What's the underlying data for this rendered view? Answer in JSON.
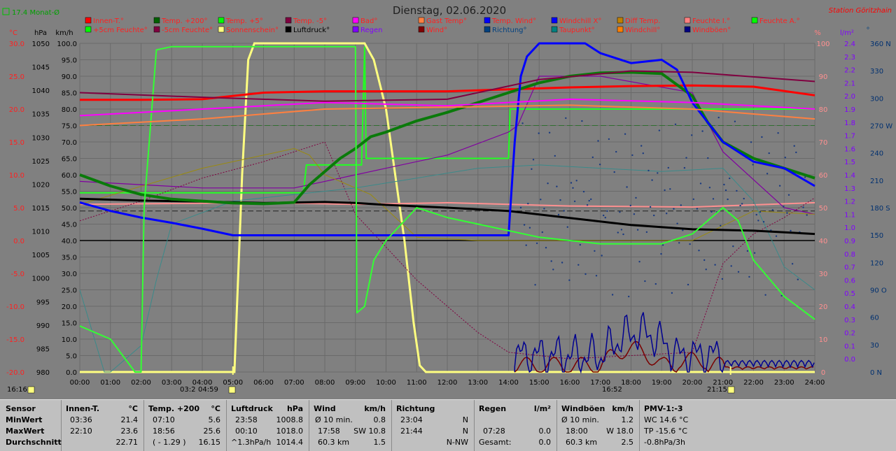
{
  "header": {
    "title": "Dienstag, 02.06.2020",
    "station": "Station Göritzhain",
    "month_avg": "17.4 Monat-Ø"
  },
  "axes": {
    "temp_label": "°C",
    "pressure_label": "hPa",
    "wind_label": "km/h",
    "humidity_label": "%",
    "rain_label": "l/m²",
    "direction_label": "°",
    "temp_ticks": [
      "30.0",
      "25.0",
      "20.0",
      "15.0",
      "10.0",
      "5.0",
      "0.0",
      "-5.0",
      "-10.0",
      "-15.0",
      "-20.0"
    ],
    "pressure_ticks": [
      "1050",
      "1045",
      "1040",
      "1035",
      "1030",
      "1025",
      "1020",
      "1015",
      "1010",
      "1005",
      "1000",
      "995",
      "990",
      "985",
      "980"
    ],
    "wind_ticks": [
      "100.0",
      "95.0",
      "90.0",
      "85.0",
      "80.0",
      "75.0",
      "70.0",
      "65.0",
      "60.0",
      "55.0",
      "50.0",
      "45.0",
      "40.0",
      "35.0",
      "30.0",
      "25.0",
      "20.0",
      "15.0",
      "10.0",
      "5.0",
      "0.0"
    ],
    "humidity_ticks": [
      "100",
      "90",
      "80",
      "70",
      "60",
      "50",
      "40",
      "30",
      "20",
      "10",
      "0"
    ],
    "rain_ticks": [
      "2.4",
      "2.3",
      "2.2",
      "2.1",
      "2.0",
      "1.9",
      "1.8",
      "1.7",
      "1.6",
      "1.5",
      "1.4",
      "1.3",
      "1.2",
      "1.1",
      "1.0",
      "0.9",
      "0.8",
      "0.7",
      "0.6",
      "0.5",
      "0.4",
      "0.3",
      "0.2",
      "0.1",
      "0.0"
    ],
    "direction_ticks": [
      "360 N",
      "330",
      "300",
      "270 W",
      "240",
      "210",
      "180 S",
      "150",
      "120",
      "90 O",
      "60",
      "30",
      "0   N"
    ],
    "time_ticks": [
      "00:00",
      "01:00",
      "02:00",
      "03:00",
      "04:00",
      "05:00",
      "06:00",
      "07:00",
      "08:00",
      "09:00",
      "10:00",
      "11:00",
      "12:00",
      "13:00",
      "14:00",
      "15:00",
      "16:00",
      "17:00",
      "18:00",
      "19:00",
      "20:00",
      "21:00",
      "22:00",
      "23:00",
      "24:00"
    ],
    "sun_marks": [
      "16:16",
      "03:2",
      "04:59",
      "16:52",
      "21:15"
    ]
  },
  "legend": [
    {
      "label": "Innen-T.°",
      "color": "#ff0000",
      "text": "#ff2020"
    },
    {
      "label": "Temp. +200°",
      "color": "#006000",
      "text": "#ff2020"
    },
    {
      "label": "Temp. +5°",
      "color": "#00ff00",
      "text": "#ff2020"
    },
    {
      "label": "Temp. -5°",
      "color": "#800040",
      "text": "#ff2020"
    },
    {
      "label": "Bad°",
      "color": "#ff00ff",
      "text": "#ff2020"
    },
    {
      "label": "Gast Temp°",
      "color": "#ff8040",
      "text": "#ff2020"
    },
    {
      "label": "Temp. Wind°",
      "color": "#0000ff",
      "text": "#ff2020"
    },
    {
      "label": "Windchill X°",
      "color": "#0000ff",
      "text": "#ff2020"
    },
    {
      "label": "Diff Temp.",
      "color": "#c08000",
      "text": "#ff2020"
    },
    {
      "label": "Feuchte I.°",
      "color": "#ff8080",
      "text": "#ff2020"
    },
    {
      "label": "Feuchte A.°",
      "color": "#00ff00",
      "text": "#ff2020"
    },
    {
      "label": "+5cm Feuchte°",
      "color": "#00ff00",
      "text": "#ff2020"
    },
    {
      "label": "-5cm Feuchte°",
      "color": "#800040",
      "text": "#ff2020"
    },
    {
      "label": "Sonnenschein°",
      "color": "#ffff80",
      "text": "#ff2020"
    },
    {
      "label": "Luftdruck°",
      "color": "#000000",
      "text": "#000000"
    },
    {
      "label": "Regen",
      "color": "#8000ff",
      "text": "#8000ff"
    },
    {
      "label": "Wind°",
      "color": "#800000",
      "text": "#ff2020"
    },
    {
      "label": "Richtung°",
      "color": "#004080",
      "text": "#004080"
    },
    {
      "label": "Taupunkt°",
      "color": "#008080",
      "text": "#ff2020"
    },
    {
      "label": "Windchill°",
      "color": "#ff8000",
      "text": "#ff2020"
    },
    {
      "label": "Windböen°",
      "color": "#000080",
      "text": "#ff2020"
    }
  ],
  "chart_data": {
    "type": "line",
    "title": "Dienstag, 02.06.2020",
    "x_unit": "hours",
    "xlim": [
      0,
      24
    ],
    "ylim_temp": [
      -20,
      30
    ],
    "ylim_pressure": [
      980,
      1050
    ],
    "ylim_wind": [
      0,
      100
    ],
    "ylim_humidity": [
      0,
      100
    ],
    "ylim_rain": [
      0,
      2.5
    ],
    "ylim_direction": [
      0,
      360
    ],
    "series": [
      {
        "name": "Luftdruck",
        "axis": "pressure",
        "color": "#000000",
        "width": 3,
        "points": [
          [
            0,
            1016.9
          ],
          [
            2,
            1016.5
          ],
          [
            4,
            1016.3
          ],
          [
            6,
            1016
          ],
          [
            8,
            1016.2
          ],
          [
            9,
            1016
          ],
          [
            10,
            1015.6
          ],
          [
            12,
            1015
          ],
          [
            14,
            1014.3
          ],
          [
            16,
            1012.8
          ],
          [
            18,
            1011.3
          ],
          [
            20,
            1010.4
          ],
          [
            22,
            1010.1
          ],
          [
            24,
            1009.4
          ]
        ]
      },
      {
        "name": "Innen-T.",
        "axis": "temp",
        "color": "#ff0000",
        "width": 3,
        "points": [
          [
            0,
            21.4
          ],
          [
            2,
            21.4
          ],
          [
            4,
            21.5
          ],
          [
            6,
            22.5
          ],
          [
            8,
            22.7
          ],
          [
            10,
            22.7
          ],
          [
            12,
            22.7
          ],
          [
            14,
            23
          ],
          [
            16,
            23.3
          ],
          [
            18,
            23.5
          ],
          [
            20,
            23.6
          ],
          [
            22,
            23.4
          ],
          [
            24,
            22.1
          ]
        ]
      },
      {
        "name": "Temp. +200",
        "axis": "temp",
        "color": "#0a7a0a",
        "width": 4,
        "points": [
          [
            0,
            10
          ],
          [
            1,
            8.3
          ],
          [
            2,
            7
          ],
          [
            3,
            6.3
          ],
          [
            4,
            6
          ],
          [
            5,
            5.7
          ],
          [
            6,
            5.6
          ],
          [
            7,
            5.8
          ],
          [
            7.5,
            8.5
          ],
          [
            8,
            10.5
          ],
          [
            8.5,
            12.5
          ],
          [
            9,
            14
          ],
          [
            9.5,
            15.8
          ],
          [
            10,
            16.5
          ],
          [
            11,
            18.2
          ],
          [
            12,
            19.5
          ],
          [
            13,
            21
          ],
          [
            14,
            22.5
          ],
          [
            15,
            24
          ],
          [
            16,
            25
          ],
          [
            17,
            25.5
          ],
          [
            18,
            25.6
          ],
          [
            19,
            25.4
          ],
          [
            20,
            22
          ],
          [
            20.5,
            18
          ],
          [
            21,
            15
          ],
          [
            22,
            12.5
          ],
          [
            23,
            11
          ],
          [
            24,
            9.5
          ]
        ]
      },
      {
        "name": "Temp. Wind",
        "axis": "temp",
        "color": "#0000ff",
        "width": 3,
        "points": [
          [
            0,
            5.8
          ],
          [
            1,
            4.5
          ],
          [
            2,
            3.5
          ],
          [
            3,
            2.7
          ],
          [
            4,
            1.8
          ],
          [
            5,
            0.8
          ],
          [
            6,
            0.8
          ],
          [
            7,
            0.8
          ],
          [
            8,
            0.8
          ],
          [
            9,
            0.8
          ],
          [
            10,
            0.8
          ],
          [
            11,
            0.8
          ],
          [
            12,
            0.8
          ],
          [
            13,
            0.8
          ],
          [
            14,
            0.8
          ],
          [
            14.2,
            15
          ],
          [
            14.4,
            25
          ],
          [
            14.6,
            28
          ],
          [
            15,
            30
          ],
          [
            16,
            30
          ],
          [
            16.5,
            30
          ],
          [
            17,
            28.5
          ],
          [
            18,
            27
          ],
          [
            19,
            27.5
          ],
          [
            19.5,
            26
          ],
          [
            20,
            21
          ],
          [
            21,
            15
          ],
          [
            22,
            12
          ],
          [
            23,
            11
          ],
          [
            24,
            8.3
          ]
        ]
      },
      {
        "name": "Temp. +5",
        "axis": "temp",
        "color": "#33ff33",
        "width": 2,
        "points": [
          [
            0,
            -13
          ],
          [
            1,
            -15
          ],
          [
            1.8,
            -20
          ],
          [
            2,
            -20
          ],
          [
            2.1,
            5
          ],
          [
            2.5,
            29
          ],
          [
            3,
            29.5
          ],
          [
            4,
            29.5
          ],
          [
            5,
            29.5
          ],
          [
            6,
            29.5
          ],
          [
            7,
            29.5
          ],
          [
            8,
            29.5
          ],
          [
            9,
            29.5
          ],
          [
            9.05,
            -11
          ],
          [
            9.3,
            -10
          ],
          [
            9.6,
            -3
          ],
          [
            10,
            0
          ],
          [
            11,
            5
          ],
          [
            12,
            3.5
          ],
          [
            13,
            2.5
          ],
          [
            14,
            1.5
          ],
          [
            15,
            0.5
          ],
          [
            16,
            0
          ],
          [
            17,
            -0.5
          ],
          [
            18,
            -0.5
          ],
          [
            19,
            -0.5
          ],
          [
            20,
            1
          ],
          [
            21,
            5
          ],
          [
            21.5,
            3
          ],
          [
            22,
            -3
          ],
          [
            23,
            -8.5
          ],
          [
            24,
            -12
          ]
        ]
      },
      {
        "name": "Bad",
        "axis": "temp",
        "color": "#ff00ff",
        "width": 2,
        "points": [
          [
            0,
            19
          ],
          [
            4,
            20
          ],
          [
            8,
            21
          ],
          [
            12,
            20.5
          ],
          [
            16,
            21.5
          ],
          [
            20,
            21
          ],
          [
            24,
            20
          ]
        ]
      },
      {
        "name": "Gast Temp",
        "axis": "temp",
        "color": "#ff8040",
        "width": 2,
        "points": [
          [
            0,
            17.5
          ],
          [
            4,
            18.5
          ],
          [
            8,
            20
          ],
          [
            12,
            20.3
          ],
          [
            16,
            20.6
          ],
          [
            20,
            20
          ],
          [
            24,
            18.5
          ]
        ]
      },
      {
        "name": "Temp. -5",
        "axis": "temp",
        "color": "#800040",
        "width": 2,
        "points": [
          [
            0,
            22.5
          ],
          [
            4,
            21.8
          ],
          [
            8,
            21.2
          ],
          [
            12,
            21.5
          ],
          [
            15,
            24.5
          ],
          [
            18,
            25.8
          ],
          [
            20,
            25.6
          ],
          [
            24,
            24.2
          ]
        ]
      }
    ],
    "stats_rows": [
      "MinWert",
      "MaxWert",
      "Durchschnitt"
    ]
  },
  "stats": {
    "sensor_col": {
      "header": "Sensor",
      "rows": [
        "MinWert",
        "MaxWert",
        "Durchschnitt"
      ]
    },
    "innen": {
      "header": "Innen-T.",
      "unit": "°C",
      "rows": [
        [
          "03:36",
          "21.4"
        ],
        [
          "22:10",
          "23.6"
        ],
        [
          "",
          "22.71"
        ]
      ]
    },
    "temp": {
      "header": "Temp. +200",
      "unit": "°C",
      "rows": [
        [
          "07:10",
          "5.6"
        ],
        [
          "18:56",
          "25.6"
        ],
        [
          "( - 1.29 )",
          "16.15"
        ]
      ]
    },
    "druck": {
      "header": "Luftdruck",
      "unit": "hPa",
      "rows": [
        [
          "23:58",
          "1008.8"
        ],
        [
          "00:10",
          "1018.0"
        ],
        [
          "^1.3hPa/h",
          "1014.4"
        ]
      ]
    },
    "wind": {
      "header": "Wind",
      "unit": "km/h",
      "rows": [
        [
          "Ø 10 min.",
          "0.8"
        ],
        [
          "17:58",
          "SW 10.8"
        ],
        [
          "60.3 km",
          "1.5"
        ]
      ]
    },
    "richtung": {
      "header": "Richtung",
      "unit": "",
      "rows": [
        [
          "23:04",
          "N"
        ],
        [
          "21:44",
          "N"
        ],
        [
          "",
          "N-NW"
        ]
      ]
    },
    "regen": {
      "header": "Regen",
      "unit": "l/m²",
      "rows": [
        [
          "",
          ""
        ],
        [
          "07:28",
          "0.0"
        ],
        [
          "Gesamt:",
          "0.0"
        ]
      ]
    },
    "boeen": {
      "header": "Windböen",
      "unit": "km/h",
      "rows": [
        [
          "Ø 10 min.",
          "1.2"
        ],
        [
          "18:00",
          "W 18.0"
        ],
        [
          "60.3 km",
          "2.5"
        ]
      ]
    },
    "pmv": {
      "header": "PMV-1:-3",
      "rows": [
        "WC 14.6 °C",
        "TP -15.6 °C",
        "-0.8hPa/3h"
      ]
    }
  }
}
